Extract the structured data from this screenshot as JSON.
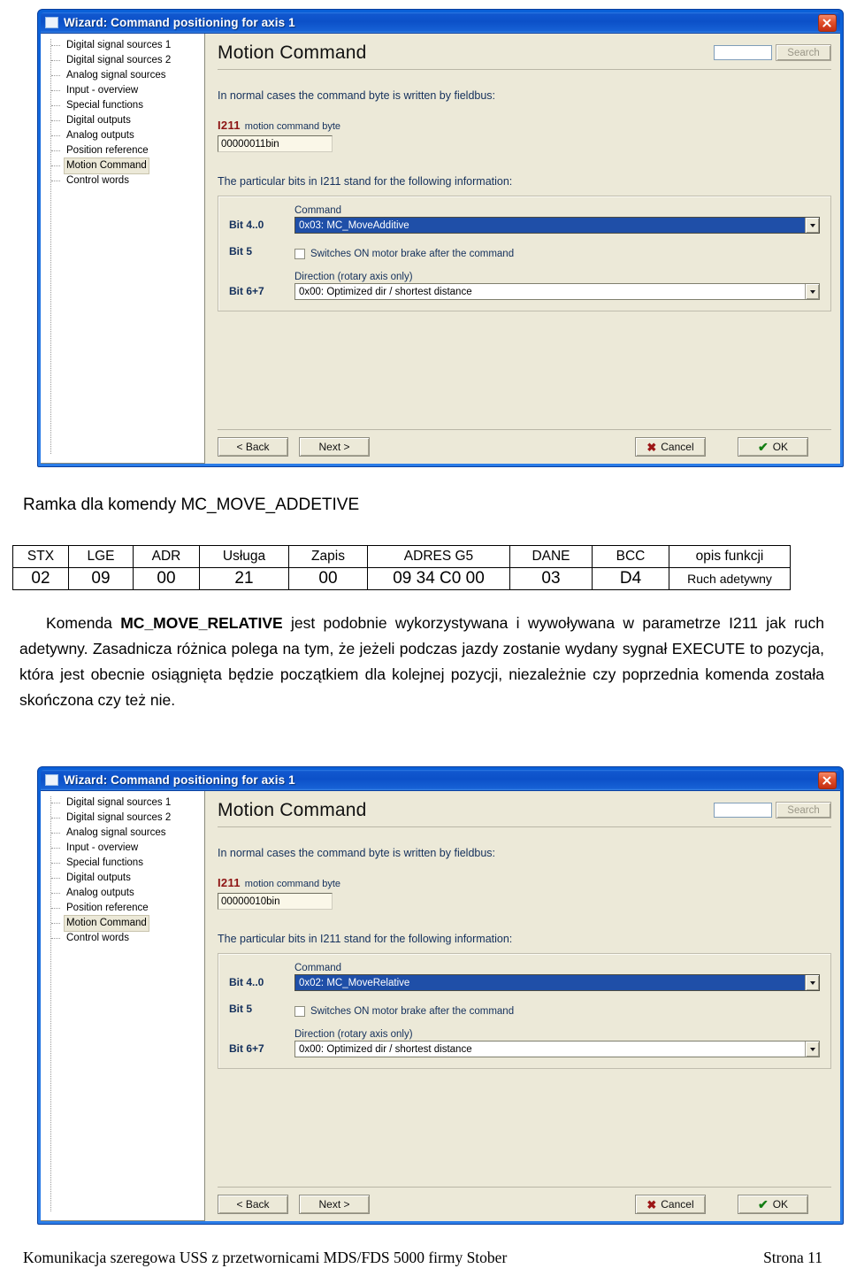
{
  "dialogs": [
    {
      "title": "Wizard: Command positioning for axis 1",
      "tree": [
        "Digital signal sources 1",
        "Digital signal sources 2",
        "Analog signal sources",
        "Input - overview",
        "Special functions",
        "Digital outputs",
        "Analog outputs",
        "Position reference",
        "Motion Command",
        "Control words"
      ],
      "selected_tree_index": 8,
      "pane_title": "Motion Command",
      "search": {
        "value": "",
        "placeholder": "",
        "button_label": "Search"
      },
      "intro_text": "In normal cases the command byte is written by fieldbus:",
      "param": {
        "code": "I211",
        "caption": "motion command byte",
        "value": "00000011bin"
      },
      "bits_intro": "The particular bits in I211 stand for the following information:",
      "bits": {
        "command_label": "Bit 4..0",
        "command_caption": "Command",
        "command_value": "0x03: MC_MoveAdditive",
        "brake_label": "Bit 5",
        "brake_text": "Switches ON motor brake after the command",
        "brake_checked": "false",
        "direction_label": "Bit 6+7",
        "direction_caption": "Direction (rotary axis only)",
        "direction_value": "0x00: Optimized dir / shortest distance"
      },
      "buttons": {
        "back": "< Back",
        "next": "Next >",
        "cancel": "Cancel",
        "ok": "OK"
      }
    },
    {
      "title": "Wizard: Command positioning for axis 1",
      "tree": [
        "Digital signal sources 1",
        "Digital signal sources 2",
        "Analog signal sources",
        "Input - overview",
        "Special functions",
        "Digital outputs",
        "Analog outputs",
        "Position reference",
        "Motion Command",
        "Control words"
      ],
      "selected_tree_index": 8,
      "pane_title": "Motion Command",
      "search": {
        "value": "",
        "placeholder": "",
        "button_label": "Search"
      },
      "intro_text": "In normal cases the command byte is written by fieldbus:",
      "param": {
        "code": "I211",
        "caption": "motion command byte",
        "value": "00000010bin"
      },
      "bits_intro": "The particular bits in I211 stand for the following information:",
      "bits": {
        "command_label": "Bit 4..0",
        "command_caption": "Command",
        "command_value": "0x02: MC_MoveRelative",
        "brake_label": "Bit 5",
        "brake_text": "Switches ON motor brake after the command",
        "brake_checked": "false",
        "direction_label": "Bit 6+7",
        "direction_caption": "Direction (rotary axis only)",
        "direction_value": "0x00: Optimized dir / shortest distance"
      },
      "buttons": {
        "back": "< Back",
        "next": "Next >",
        "cancel": "Cancel",
        "ok": "OK"
      }
    }
  ],
  "document": {
    "heading": "Ramka dla komendy MC_MOVE_ADDETIVE",
    "frame_table": {
      "headers": [
        "STX",
        "LGE",
        "ADR",
        "Usługa",
        "Zapis",
        "ADRES G5",
        "DANE",
        "BCC",
        "opis funkcji"
      ],
      "values": [
        "02",
        "09",
        "00",
        "21",
        "00",
        "09 34 C0 00",
        "03",
        "D4",
        "Ruch adetywny"
      ]
    },
    "paragraph": {
      "lead": "Komenda ",
      "bold": "MC_MOVE_RELATIVE",
      "rest": " jest podobnie wykorzystywana i wywoływana w parametrze I211 jak ruch adetywny. Zasadnicza różnica polega na tym, że jeżeli podczas jazdy zostanie wydany sygnał EXECUTE to pozycja, która jest obecnie osiągnięta będzie początkiem dla kolejnej pozycji, niezależnie czy poprzednia komenda została skończona czy też nie."
    },
    "footer": {
      "text": "Komunikacja szeregowa USS z przetwornicami MDS/FDS 5000 firmy Stober",
      "page": "Strona 11"
    }
  },
  "colors": {
    "title_blue": "#0c50c8",
    "dialog_face": "#ece9d8",
    "selection_blue": "#1f4fa8",
    "param_red": "#8e1414",
    "label_navy": "#14305c"
  }
}
